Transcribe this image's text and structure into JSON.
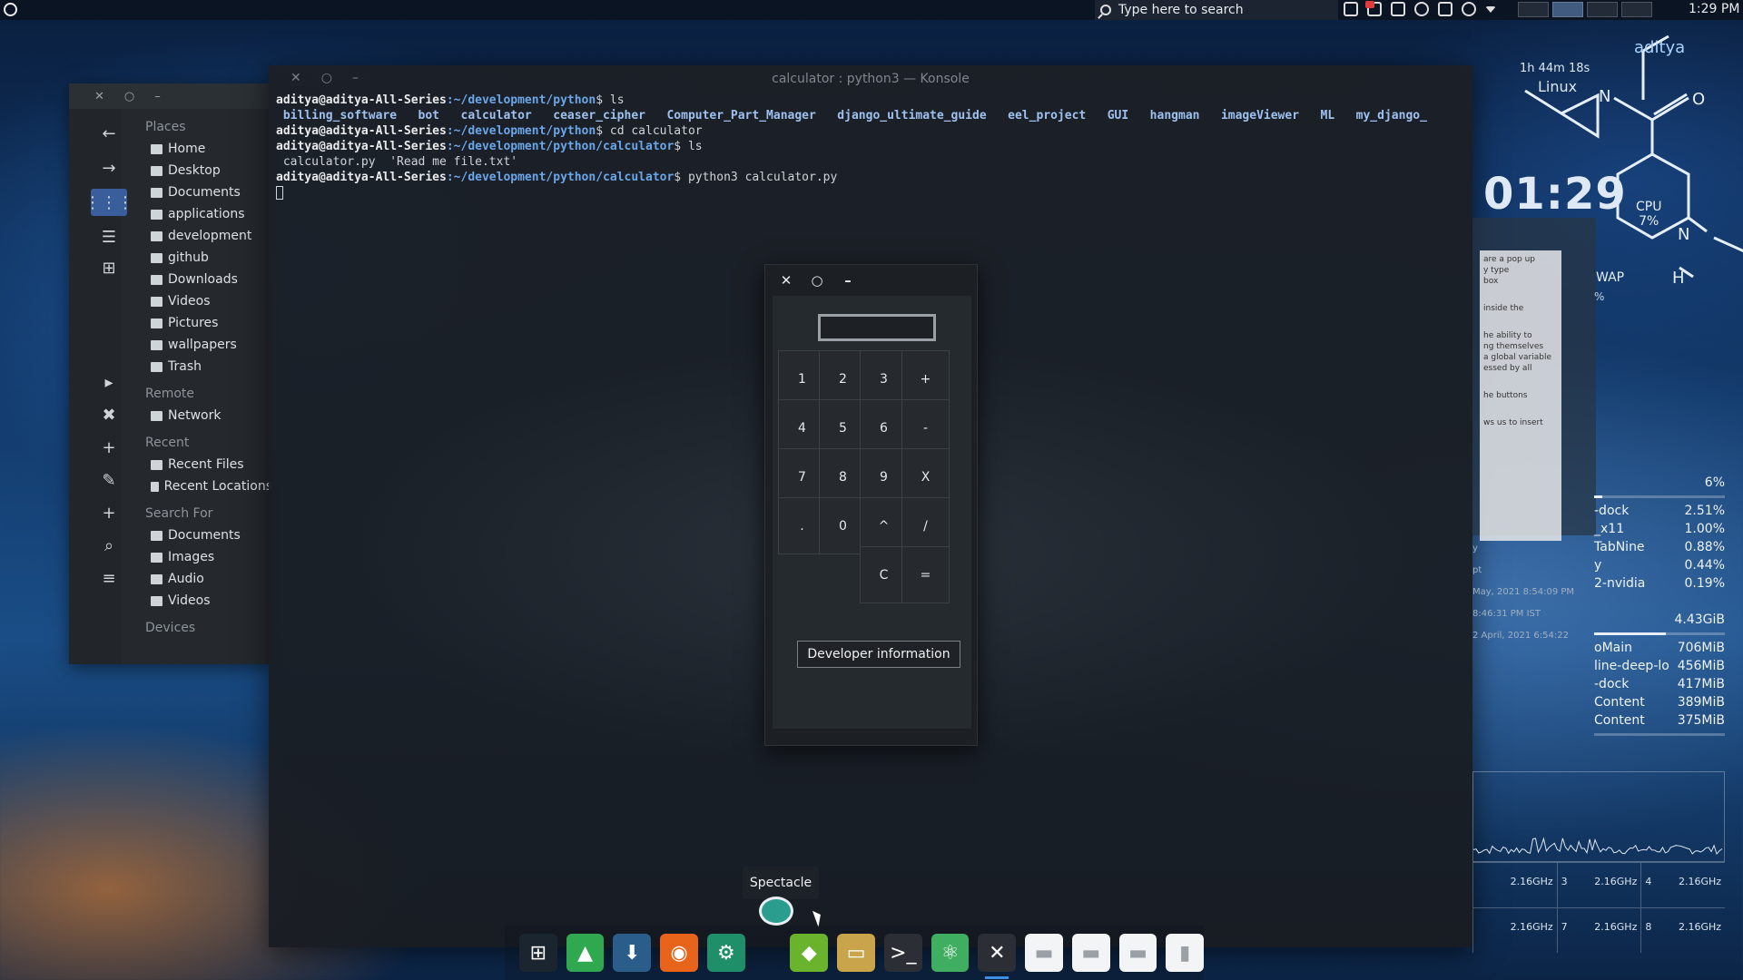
{
  "top_panel": {
    "search_placeholder": "Type here to search",
    "time": "1:29 PM"
  },
  "file_manager": {
    "sections": [
      {
        "title": "Places",
        "items": [
          "Home",
          "Desktop",
          "Documents",
          "applications",
          "development",
          "github",
          "Downloads",
          "Videos",
          "Pictures",
          "wallpapers",
          "Trash"
        ]
      },
      {
        "title": "Remote",
        "items": [
          "Network"
        ]
      },
      {
        "title": "Recent",
        "items": [
          "Recent Files",
          "Recent Locations"
        ]
      },
      {
        "title": "Search For",
        "items": [
          "Documents",
          "Images",
          "Audio",
          "Videos"
        ]
      },
      {
        "title": "Devices",
        "items": []
      }
    ]
  },
  "konsole": {
    "title": "calculator : python3 — Konsole",
    "lines": [
      {
        "user": "aditya@aditya-All-Series",
        "path": ":~/development/python",
        "cmd": "$ ls"
      },
      {
        "output": " billing_software   bot   calculator   ceaser_cipher   Computer_Part_Manager   django_ultimate_guide   eel_project   GUI   hangman   imageViewer   ML   my_django_"
      },
      {
        "user": "aditya@aditya-All-Series",
        "path": ":~/development/python",
        "cmd": "$ cd calculator"
      },
      {
        "user": "aditya@aditya-All-Series",
        "path": ":~/development/python/calculator",
        "cmd": "$ ls"
      },
      {
        "output": " calculator.py  'Read me file.txt'"
      },
      {
        "user": "aditya@aditya-All-Series",
        "path": ":~/development/python/calculator",
        "cmd": "$ python3 calculator.py"
      }
    ]
  },
  "calculator": {
    "display_value": "",
    "keys": [
      "1",
      "2",
      "3",
      "+",
      "4",
      "5",
      "6",
      "-",
      "7",
      "8",
      "9",
      "X",
      ".",
      "0",
      "^",
      "/",
      "C",
      "="
    ],
    "developer_button": "Developer information"
  },
  "widgets": {
    "user": "aditya",
    "uptime": "1h 44m 18s",
    "os": "Linux",
    "clock": "01:29",
    "cpu_label": "CPU",
    "cpu_value": "7%",
    "swap_label": "WAP",
    "swap_value": "%",
    "atom_n": "N",
    "atom_h": "H",
    "atom_o": "O",
    "cpu_total": "6%",
    "cpu_procs": [
      {
        "name": "-dock",
        "value": "2.51%"
      },
      {
        "name": "_x11",
        "value": "1.00%"
      },
      {
        "name": "TabNine",
        "value": "0.88%"
      },
      {
        "name": "y",
        "value": "0.44%"
      },
      {
        "name": "2-nvidia",
        "value": "0.19%"
      }
    ],
    "mem_total": "4.43GiB",
    "mem_procs": [
      {
        "name": "oMain",
        "value": "706MiB"
      },
      {
        "name": "line-deep-lo",
        "value": "456MiB"
      },
      {
        "name": "-dock",
        "value": "417MiB"
      },
      {
        "name": "Content",
        "value": "389MiB"
      },
      {
        "name": "Content",
        "value": "375MiB"
      }
    ],
    "cpu_load_fraction": 0.06,
    "mem_fraction": 0.55,
    "cores": [
      {
        "label": "",
        "freq": "2.16GHz"
      },
      {
        "label": "3",
        "freq": "2.16GHz"
      },
      {
        "label": "4",
        "freq": "2.16GHz"
      },
      {
        "label": "",
        "freq": "2.16GHz"
      },
      {
        "label": "7",
        "freq": "2.16GHz"
      },
      {
        "label": "8",
        "freq": "2.16GHz"
      }
    ],
    "ghost_card_lines": [
      "are a pop up",
      "y type",
      "box",
      "inside the",
      "he ability to",
      "ng themselves",
      "a global variable",
      "essed by all",
      "he buttons",
      "ws us to insert"
    ],
    "ghost_list": [
      "y",
      "pt",
      "May, 2021 8:54:09 PM",
      "8:46:31 PM IST",
      "2 April, 2021 6:54:22"
    ]
  },
  "tooltip": "Spectacle",
  "dock": {
    "icons": [
      {
        "name": "app-grid-icon",
        "color": "#1b2530"
      },
      {
        "name": "system-monitor-icon",
        "color": "#2fa84f"
      },
      {
        "name": "software-store-icon",
        "color": "#2a5d8a"
      },
      {
        "name": "firefox-icon",
        "color": "#e8641b"
      },
      {
        "name": "usb-imager-icon",
        "color": "#1f8f6a"
      },
      {
        "name": "nvidia-icon",
        "color": "#6ab42d"
      },
      {
        "name": "archive-manager-icon",
        "color": "#c9a44b"
      },
      {
        "name": "terminal-icon",
        "color": "#2b2f35"
      },
      {
        "name": "atom-icon",
        "color": "#3fae61"
      },
      {
        "name": "xorg-icon",
        "color": "#2b2f35"
      },
      {
        "name": "folder-icon",
        "color": "#f2f4f6"
      },
      {
        "name": "folder-icon",
        "color": "#f2f4f6"
      },
      {
        "name": "folder-icon",
        "color": "#f2f4f6"
      },
      {
        "name": "trash-icon",
        "color": "#f2f4f6"
      }
    ]
  }
}
